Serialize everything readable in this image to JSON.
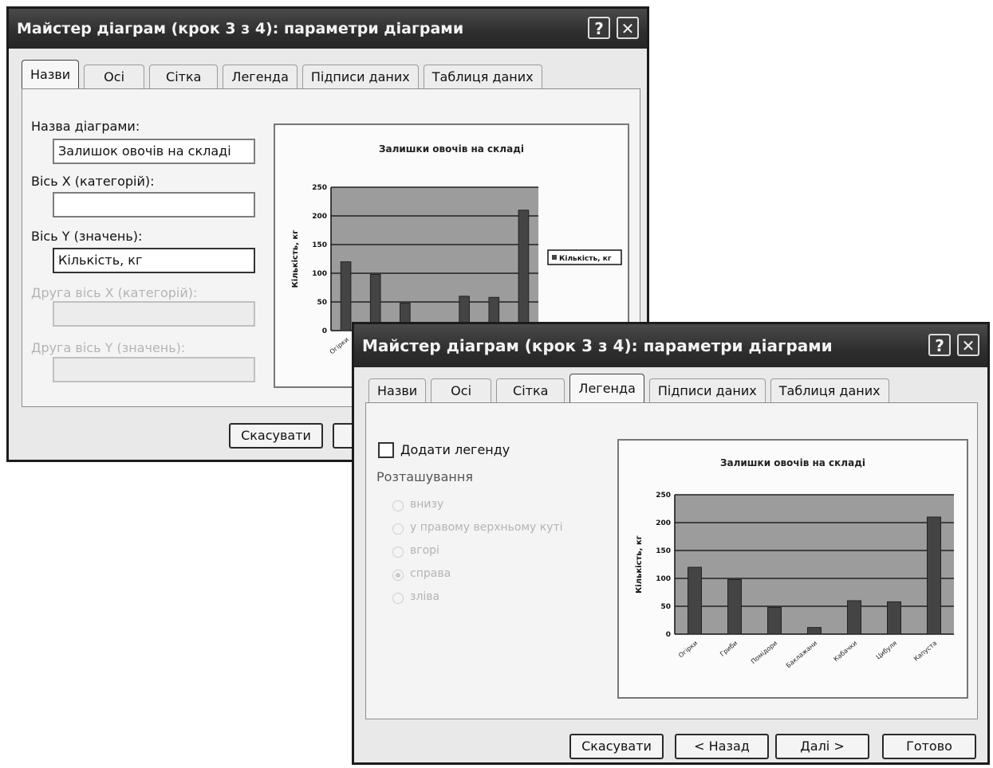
{
  "dialog_back": {
    "title": "Майстер діаграм (крок 3 з 4): параметри діаграми",
    "help_glyph": "?",
    "close_glyph": "✕",
    "tabs": [
      {
        "label": "Назви"
      },
      {
        "label": "Осі"
      },
      {
        "label": "Сітка"
      },
      {
        "label": "Легенда"
      },
      {
        "label": "Підписи даних"
      },
      {
        "label": "Таблиця даних"
      }
    ],
    "form": {
      "chart_title_label": "Назва діаграми:",
      "chart_title_value": "Залишок овочів на складі",
      "x_axis_label": "Вісь X (категорій):",
      "x_axis_value": "",
      "y_axis_label": "Вісь Y (значень):",
      "y_axis_value": "Кількість, кг",
      "second_x_label": "Друга вісь X (категорій):",
      "second_x_value": "",
      "second_y_label": "Друга вісь Y (значень):",
      "second_y_value": ""
    },
    "preview": {
      "title": "Залишки овочів на складі",
      "legend": "Кількість, кг"
    },
    "buttons": {
      "cancel": "Скасувати"
    }
  },
  "dialog_front": {
    "title": "Майстер діаграм (крок 3 з 4): параметри діаграми",
    "help_glyph": "?",
    "close_glyph": "✕",
    "tabs": [
      {
        "label": "Назви"
      },
      {
        "label": "Осі"
      },
      {
        "label": "Сітка"
      },
      {
        "label": "Легенда"
      },
      {
        "label": "Підписи даних"
      },
      {
        "label": "Таблиця даних"
      }
    ],
    "legend_options": {
      "add_legend_label": "Додати легенду",
      "add_legend_checked": false,
      "placement_label": "Розташування",
      "placements": [
        {
          "label": "внизу",
          "selected": false
        },
        {
          "label": "у правому верхньому куті",
          "selected": false
        },
        {
          "label": "вгорі",
          "selected": false
        },
        {
          "label": "справа",
          "selected": true
        },
        {
          "label": "зліва",
          "selected": false
        }
      ]
    },
    "buttons": {
      "cancel": "Скасувати",
      "back": "< Назад",
      "next": "Далі >",
      "finish": "Готово"
    }
  },
  "chart_data": {
    "type": "bar",
    "title": "Залишки овочів на складі",
    "ylabel": "Кількість, кг",
    "xlabel": "",
    "categories": [
      "Огірки",
      "Гриби",
      "Помідори",
      "Баклажани",
      "Кабачки",
      "Цибуля",
      "Капуста"
    ],
    "series": [
      {
        "name": "Кількість, кг",
        "values": [
          120,
          98,
          48,
          12,
          60,
          58,
          210
        ]
      }
    ],
    "ylim": [
      0,
      250
    ],
    "yticks": [
      0,
      50,
      100,
      150,
      200,
      250
    ],
    "grid": true,
    "colors": {
      "plot_bg": "#9c9c9c",
      "bar": "#444444",
      "grid": "#222222"
    }
  }
}
